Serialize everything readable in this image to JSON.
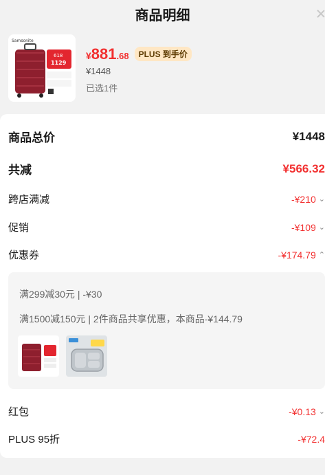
{
  "header": {
    "title": "商品明细"
  },
  "product": {
    "brand": "Samsonite",
    "badge_618": "618",
    "badge_price": "1129",
    "price_currency": "¥",
    "price_int": "881",
    "price_dec": ".68",
    "plus_tag": "PLUS 到手价",
    "original_price": "¥1448",
    "selected_count": "已选1件"
  },
  "summary": {
    "total_label": "商品总价",
    "total_value": "¥1448",
    "reduce_label": "共减",
    "reduce_value": "¥566.32",
    "cross_store_label": "跨店满减",
    "cross_store_value": "-¥210",
    "promo_label": "促销",
    "promo_value": "-¥109",
    "coupon_label": "优惠券",
    "coupon_value": "-¥174.79",
    "coupon_details": [
      "满299减30元 | -¥30",
      "满1500减150元 | 2件商品共享优惠，本商品-¥144.79"
    ],
    "redpacket_label": "红包",
    "redpacket_value": "-¥0.13",
    "plus_label": "PLUS 95折",
    "plus_value": "-¥72.4"
  },
  "colors": {
    "accent": "#f23030",
    "plus_bg": "#ffe7c4",
    "luggage": "#8e1f2e"
  },
  "icons": {
    "close": "close-icon",
    "chevron_down": "chevron-down-icon",
    "chevron_up": "chevron-up-icon"
  }
}
